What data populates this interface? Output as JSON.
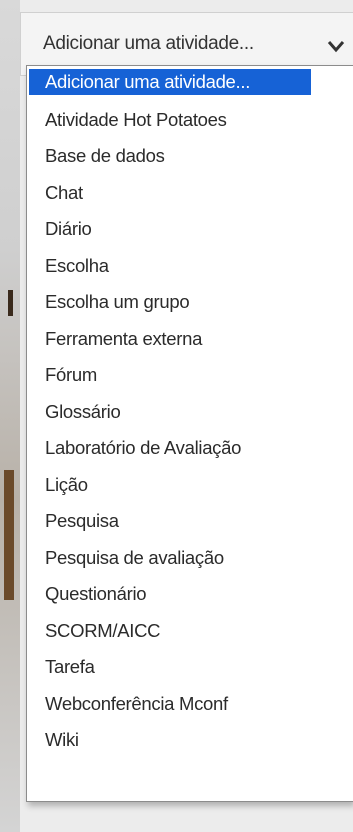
{
  "select": {
    "current_value": "Adicionar uma atividade...",
    "chevron_icon": "chevron-down-icon"
  },
  "options": [
    {
      "label": "Adicionar uma atividade...",
      "selected": true
    },
    {
      "label": "Atividade Hot Potatoes",
      "selected": false
    },
    {
      "label": "Base de dados",
      "selected": false
    },
    {
      "label": "Chat",
      "selected": false
    },
    {
      "label": "Diário",
      "selected": false
    },
    {
      "label": "Escolha",
      "selected": false
    },
    {
      "label": "Escolha um grupo",
      "selected": false
    },
    {
      "label": "Ferramenta externa",
      "selected": false
    },
    {
      "label": "Fórum",
      "selected": false
    },
    {
      "label": "Glossário",
      "selected": false
    },
    {
      "label": "Laboratório de Avaliação",
      "selected": false
    },
    {
      "label": "Lição",
      "selected": false
    },
    {
      "label": "Pesquisa",
      "selected": false
    },
    {
      "label": "Pesquisa de avaliação",
      "selected": false
    },
    {
      "label": "Questionário",
      "selected": false
    },
    {
      "label": "SCORM/AICC",
      "selected": false
    },
    {
      "label": "Tarefa",
      "selected": false
    },
    {
      "label": "Webconferência Mconf",
      "selected": false
    },
    {
      "label": "Wiki",
      "selected": false
    }
  ],
  "colors": {
    "highlight": "#1662d6",
    "text": "#2b2b2b"
  }
}
